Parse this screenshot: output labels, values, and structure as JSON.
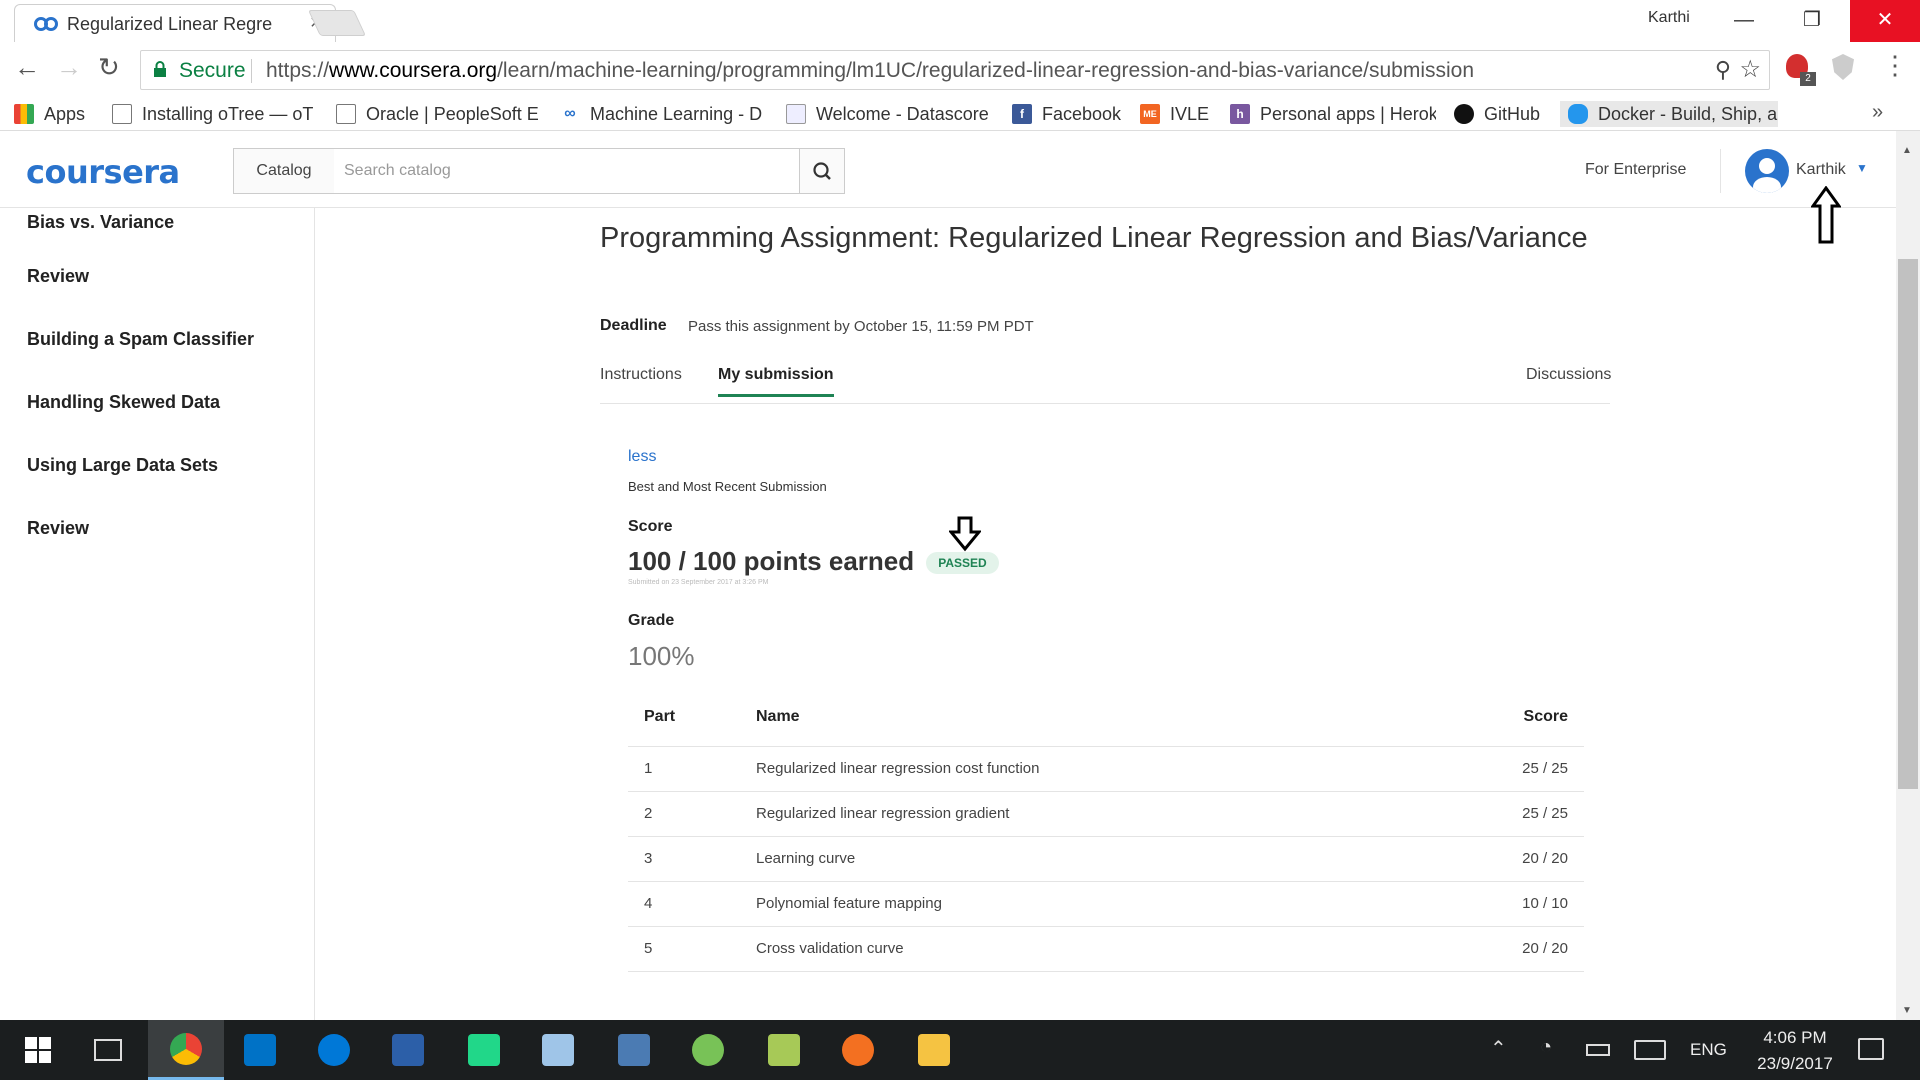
{
  "browser": {
    "tab_title": "Regularized Linear Regre",
    "window_user": "Karthi",
    "secure_label": "Secure",
    "url_scheme": "https://",
    "url_host": "www.coursera.org",
    "url_path": "/learn/machine-learning/programming/lm1UC/regularized-linear-regression-and-bias-variance/submission",
    "extension_badge": "2",
    "bookmarks": [
      {
        "label": "Apps",
        "icon": "apps-grid-icon"
      },
      {
        "label": "Installing oTree — oT",
        "icon": "page-icon"
      },
      {
        "label": "Oracle | PeopleSoft E",
        "icon": "page-icon"
      },
      {
        "label": "Machine Learning - D",
        "icon": "coursera-icon"
      },
      {
        "label": "Welcome - Datascore",
        "icon": "doc-icon"
      },
      {
        "label": "Facebook",
        "icon": "facebook-icon"
      },
      {
        "label": "IVLE",
        "icon": "ivle-icon"
      },
      {
        "label": "Personal apps | Herok",
        "icon": "heroku-icon"
      },
      {
        "label": "GitHub",
        "icon": "github-icon"
      },
      {
        "label": "Docker - Build, Ship, a",
        "icon": "docker-icon"
      }
    ]
  },
  "site": {
    "logo": "coursera",
    "catalog_label": "Catalog",
    "search_placeholder": "Search catalog",
    "enterprise_label": "For Enterprise",
    "user_name": "Karthik"
  },
  "sidebar": {
    "items": [
      {
        "label": "Bias vs. Variance"
      },
      {
        "label": "Review"
      },
      {
        "label": "Building a Spam Classifier"
      },
      {
        "label": "Handling Skewed Data"
      },
      {
        "label": "Using Large Data Sets"
      },
      {
        "label": "Review"
      }
    ]
  },
  "assignment": {
    "title": "Programming Assignment: Regularized Linear Regression and Bias/Variance",
    "deadline_label": "Deadline",
    "deadline_text": "Pass this assignment by October 15, 11:59 PM PDT",
    "tabs": [
      {
        "label": "Instructions"
      },
      {
        "label": "My submission"
      },
      {
        "label": "Discussions"
      }
    ],
    "less_link": "less",
    "submission_caption": "Best and Most Recent Submission",
    "score_label": "Score",
    "score_value": "100 / 100 points earned",
    "status_badge": "PASSED",
    "submitted_note": "Submitted on 23 September 2017 at 3:26 PM",
    "grade_label": "Grade",
    "grade_value": "100%",
    "table_headers": {
      "part": "Part",
      "name": "Name",
      "score": "Score"
    },
    "parts": [
      {
        "part": "1",
        "name": "Regularized linear regression cost function",
        "score": "25 / 25"
      },
      {
        "part": "2",
        "name": "Regularized linear regression gradient",
        "score": "25 / 25"
      },
      {
        "part": "3",
        "name": "Learning curve",
        "score": "20 / 20"
      },
      {
        "part": "4",
        "name": "Polynomial feature mapping",
        "score": "10 / 10"
      },
      {
        "part": "5",
        "name": "Cross validation curve",
        "score": "20 / 20"
      }
    ]
  },
  "taskbar": {
    "language": "ENG",
    "time": "4:06 PM",
    "date": "23/9/2017"
  },
  "colors": {
    "brand_blue": "#2a73cc",
    "pass_green": "#1f8354",
    "close_red": "#e81123"
  }
}
